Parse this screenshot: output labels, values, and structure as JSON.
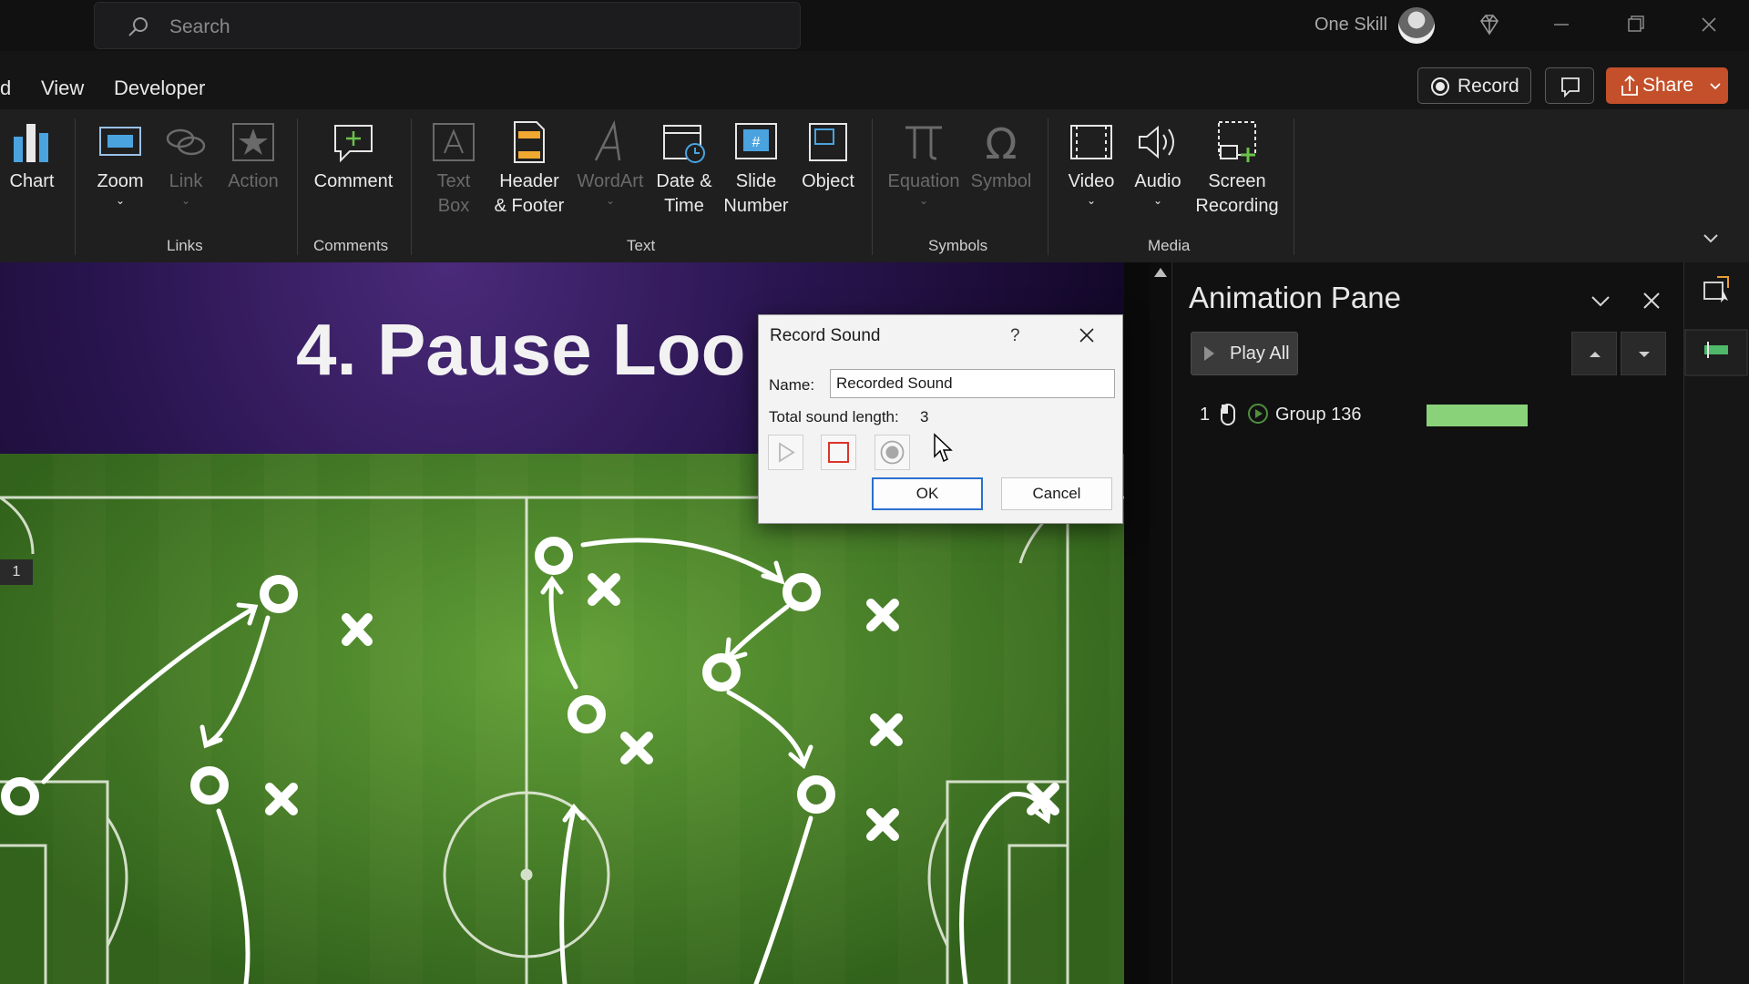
{
  "titlebar": {
    "search_placeholder": "Search",
    "user_name": "One Skill"
  },
  "menu": {
    "items": [
      "d",
      "View",
      "Developer"
    ],
    "record_label": "Record",
    "share_label": "Share"
  },
  "ribbon": {
    "buttons": {
      "chart": "Chart",
      "zoom": "Zoom",
      "link": "Link",
      "action": "Action",
      "comment": "Comment",
      "text_box": [
        "Text",
        "Box"
      ],
      "header_footer": [
        "Header",
        "& Footer"
      ],
      "wordart": "WordArt",
      "date_time": [
        "Date &",
        "Time"
      ],
      "slide_number": [
        "Slide",
        "Number"
      ],
      "object": "Object",
      "equation": "Equation",
      "symbol": "Symbol",
      "video": "Video",
      "audio": "Audio",
      "screen_recording": [
        "Screen",
        "Recording"
      ]
    },
    "groups": {
      "links": "Links",
      "comments": "Comments",
      "text": "Text",
      "symbols": "Symbols",
      "media": "Media"
    }
  },
  "slide": {
    "title": "4. Pause Loo",
    "tag": "1"
  },
  "animation_pane": {
    "title": "Animation Pane",
    "play_all": "Play All",
    "items": [
      {
        "number": "1",
        "name": "Group 136",
        "bar_color": "#8ad27a"
      }
    ]
  },
  "dialog": {
    "title": "Record Sound",
    "help": "?",
    "name_label": "Name:",
    "name_value": "Recorded Sound",
    "length_label": "Total sound length:",
    "length_value": "3",
    "ok_label": "OK",
    "cancel_label": "Cancel"
  },
  "colors": {
    "accent_share": "#c3502a",
    "dialog_default_border": "#2b6fcf",
    "stop_red": "#d9352a"
  }
}
